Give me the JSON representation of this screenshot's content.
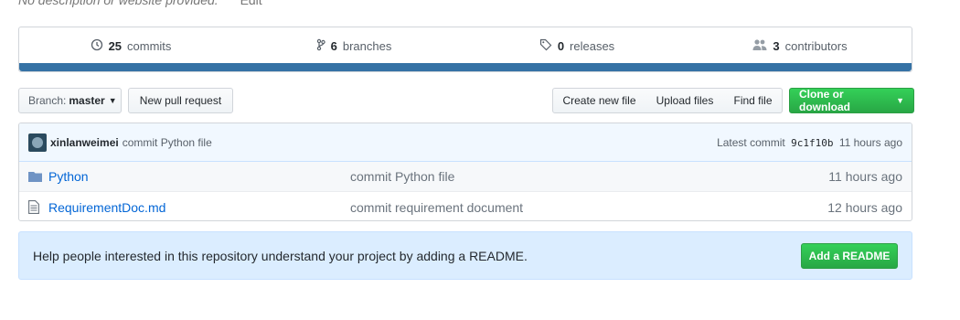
{
  "repo": {
    "description": "No description or website provided.",
    "edit_label": "Edit"
  },
  "summary": {
    "commits": {
      "count": "25",
      "label": "commits",
      "icon": "history-icon"
    },
    "branches": {
      "count": "6",
      "label": "branches",
      "icon": "branch-icon"
    },
    "releases": {
      "count": "0",
      "label": "releases",
      "icon": "tag-icon"
    },
    "contributors": {
      "count": "3",
      "label": "contributors",
      "icon": "people-icon"
    },
    "language_bar_color": "#3572a5"
  },
  "toolbar": {
    "branch_prefix": "Branch:",
    "branch_name": "master",
    "new_pull_request": "New pull request",
    "create_new_file": "Create new file",
    "upload_files": "Upload files",
    "find_file": "Find file",
    "clone_or_download": "Clone or download"
  },
  "latest_commit": {
    "author": "xinlanweimei",
    "message": "commit Python file",
    "prefix": "Latest commit",
    "sha": "9c1f10b",
    "age": "11 hours ago"
  },
  "files": [
    {
      "type": "dir",
      "icon": "folder-icon",
      "name": "Python",
      "message": "commit Python file",
      "age": "11 hours ago"
    },
    {
      "type": "file",
      "icon": "file-icon",
      "name": "RequirementDoc.md",
      "message": "commit requirement document",
      "age": "12 hours ago"
    }
  ],
  "readme_prompt": {
    "text": "Help people interested in this repository understand your project by adding a README.",
    "button": "Add a README"
  },
  "colors": {
    "accent_green": "#28a745",
    "link_blue": "#0366d6",
    "readme_bg": "#dbedff"
  }
}
